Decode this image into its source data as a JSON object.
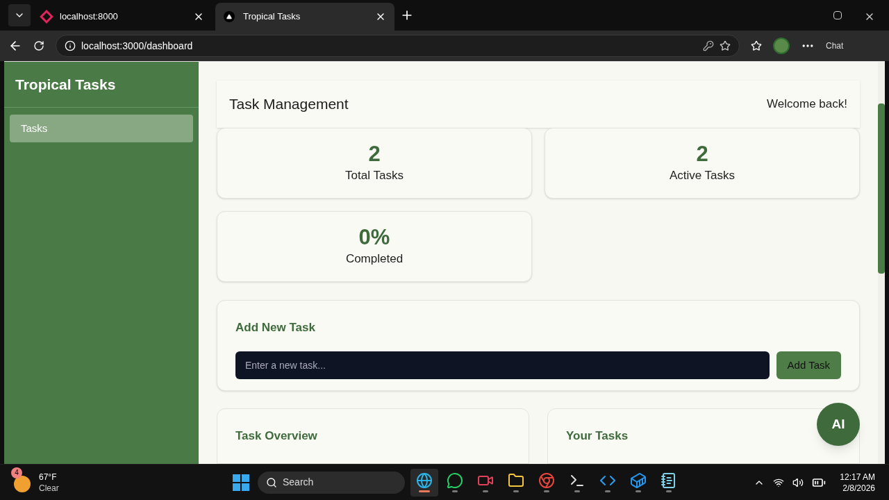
{
  "browser": {
    "tabs": [
      {
        "title": "localhost:8000",
        "selected": false
      },
      {
        "title": "Tropical Tasks",
        "selected": true
      }
    ],
    "url": "localhost:3000/dashboard",
    "chat_label": "Chat"
  },
  "sidebar": {
    "title": "Tropical Tasks",
    "items": [
      {
        "label": "Tasks",
        "selected": true
      }
    ]
  },
  "header": {
    "title": "Task Management",
    "greeting": "Welcome back!"
  },
  "stats": [
    {
      "value": "2",
      "label": "Total Tasks"
    },
    {
      "value": "2",
      "label": "Active Tasks"
    },
    {
      "value": "0%",
      "label": "Completed"
    }
  ],
  "add_task": {
    "title": "Add New Task",
    "placeholder": "Enter a new task...",
    "button": "Add Task"
  },
  "panels": [
    {
      "title": "Task Overview"
    },
    {
      "title": "Your Tasks"
    }
  ],
  "ai_button": "AI",
  "taskbar": {
    "weather": {
      "temp": "67°F",
      "condition": "Clear",
      "badge": "4"
    },
    "search": "Search",
    "apps": [
      {
        "kind": "edge",
        "active": true
      },
      {
        "kind": "whatsapp",
        "active": false
      },
      {
        "kind": "recorder",
        "active": false
      },
      {
        "kind": "folder",
        "active": false
      },
      {
        "kind": "chrome",
        "active": false
      },
      {
        "kind": "terminal",
        "active": false
      },
      {
        "kind": "vscode",
        "active": false
      },
      {
        "kind": "docker",
        "active": false
      },
      {
        "kind": "notepad",
        "active": false
      }
    ],
    "time": "12:17 AM",
    "date": "2/8/2026"
  }
}
